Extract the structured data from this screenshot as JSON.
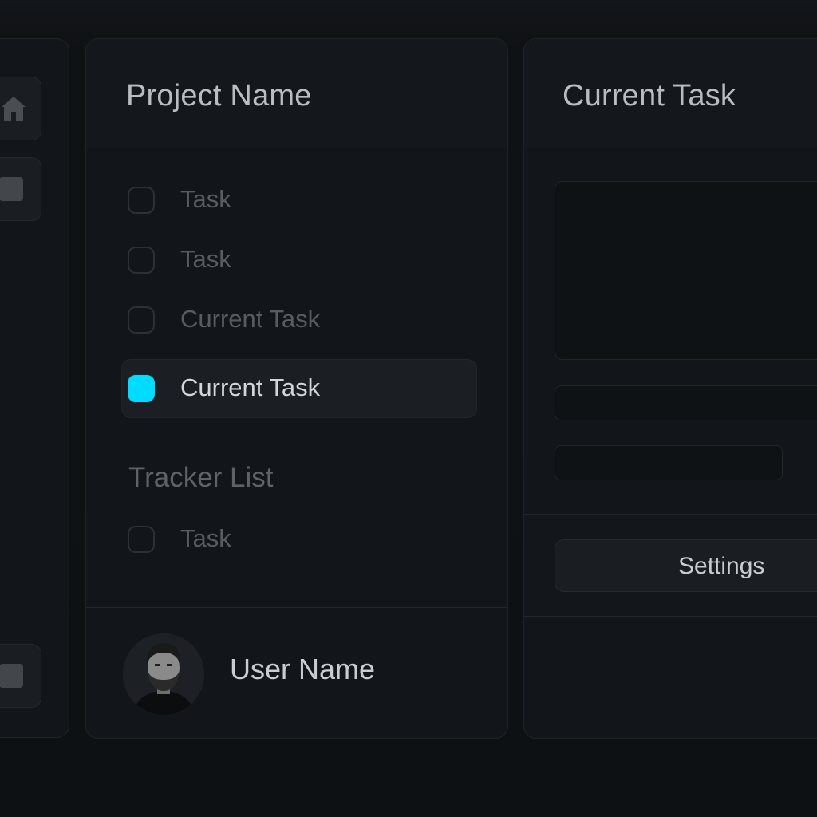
{
  "rail": {
    "items": [
      {
        "icon": "home-icon"
      },
      {
        "icon": "folder-icon"
      },
      {
        "icon": "square-icon"
      }
    ]
  },
  "project": {
    "title": "Project Name",
    "tasks": [
      {
        "label": "Task",
        "checked": false
      },
      {
        "label": "Task",
        "checked": false
      },
      {
        "label": "Current Task",
        "checked": false
      },
      {
        "label": "Current Task",
        "checked": true,
        "active": true
      }
    ],
    "tracker": {
      "title": "Tracker List",
      "tasks": [
        {
          "label": "Task",
          "checked": false
        }
      ]
    },
    "user": {
      "name": "User Name"
    }
  },
  "detail": {
    "title": "Current Task",
    "description": "",
    "field_one": "",
    "field_two": "",
    "settings_label": "Settings"
  },
  "colors": {
    "accent": "#00dcff",
    "background": "#0f1215",
    "panel": "#121519",
    "active_row": "#1b1e22"
  }
}
